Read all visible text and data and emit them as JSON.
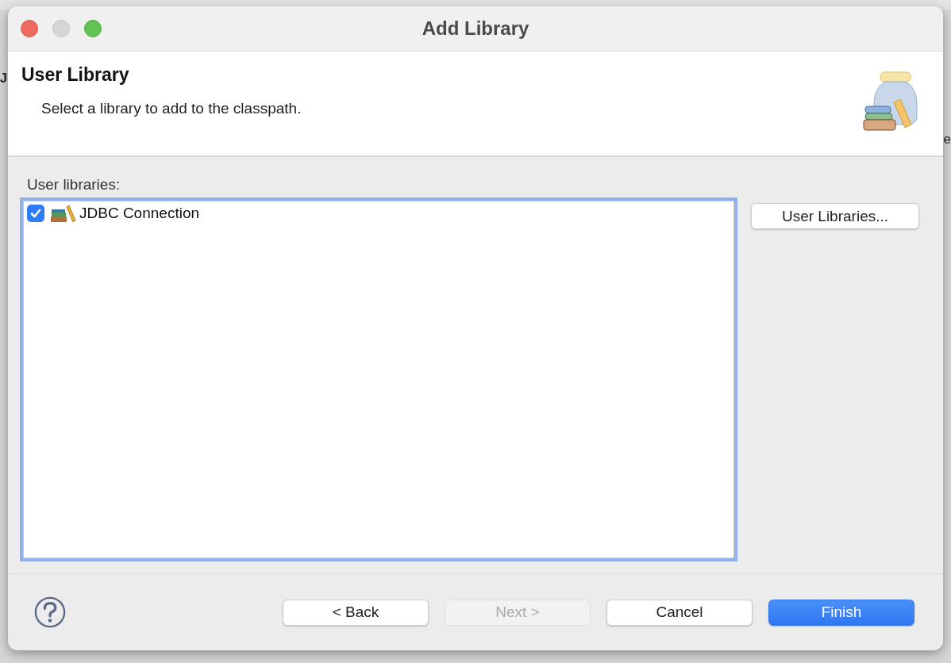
{
  "backdrop": {
    "left_fragment": "J",
    "right_fragment": "e"
  },
  "window": {
    "title": "Add Library"
  },
  "header": {
    "title": "User Library",
    "description": "Select a library to add to the classpath."
  },
  "library_list": {
    "label": "User libraries:",
    "items": [
      {
        "label": "JDBC Connection",
        "checked": true
      }
    ]
  },
  "side_buttons": [
    {
      "label": "User Libraries...",
      "disabled": false
    }
  ],
  "footer_buttons": [
    {
      "label": "< Back",
      "kind": "normal",
      "disabled": false
    },
    {
      "label": "Next >",
      "kind": "normal",
      "disabled": true
    },
    {
      "label": "Cancel",
      "kind": "normal",
      "disabled": false
    },
    {
      "label": "Finish",
      "kind": "default",
      "disabled": false
    }
  ]
}
